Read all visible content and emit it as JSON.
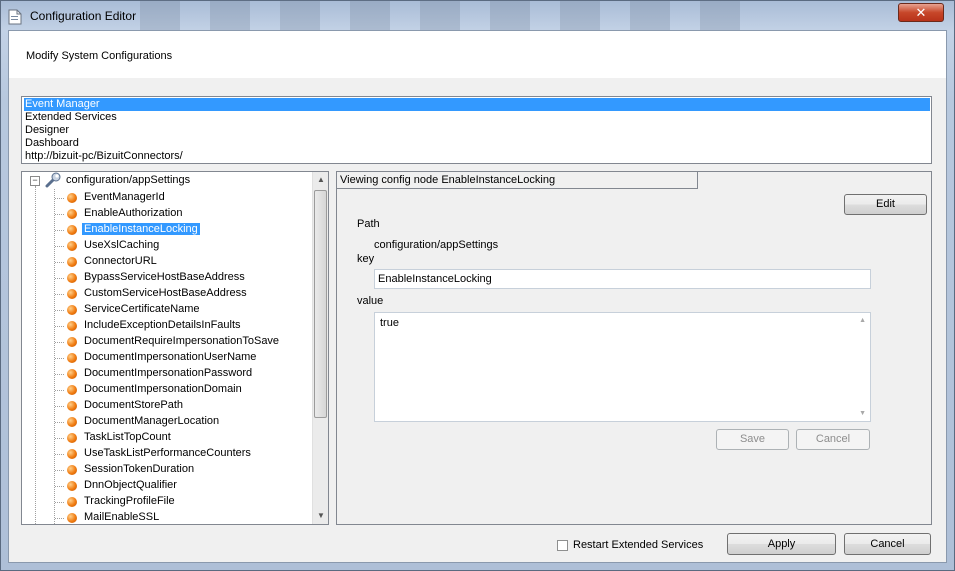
{
  "window": {
    "title": "Configuration Editor",
    "close_glyph": "✕"
  },
  "header": {
    "text": "Modify System Configurations"
  },
  "instances": [
    "Event Manager",
    "Extended Services",
    "Designer",
    "Dashboard",
    "http://bizuit-pc/BizuitConnectors/"
  ],
  "tree": {
    "root": "configuration/appSettings",
    "items": [
      "EventManagerId",
      "EnableAuthorization",
      "EnableInstanceLocking",
      "UseXslCaching",
      "ConnectorURL",
      "BypassServiceHostBaseAddress",
      "CustomServiceHostBaseAddress",
      "ServiceCertificateName",
      "IncludeExceptionDetailsInFaults",
      "DocumentRequireImpersonationToSave",
      "DocumentImpersonationUserName",
      "DocumentImpersonationPassword",
      "DocumentImpersonationDomain",
      "DocumentStorePath",
      "DocumentManagerLocation",
      "TaskListTopCount",
      "UseTaskListPerformanceCounters",
      "SessionTokenDuration",
      "DnnObjectQualifier",
      "TrackingProfileFile",
      "MailEnableSSL"
    ],
    "selected": "EnableInstanceLocking"
  },
  "details": {
    "viewing": "Viewing config node EnableInstanceLocking",
    "edit_label": "Edit",
    "path_label": "Path",
    "path_value": "configuration/appSettings",
    "key_label": "key",
    "key_value": "EnableInstanceLocking",
    "value_label": "value",
    "value_value": "true",
    "save_label": "Save",
    "cancel_label": "Cancel"
  },
  "footer": {
    "restart_label": "Restart Extended Services",
    "restart_checked": false,
    "apply_label": "Apply",
    "cancel_label": "Cancel"
  },
  "icons": {
    "leaf": "orange-bullet-icon",
    "root": "wrench-icon",
    "window": "document-icon"
  }
}
